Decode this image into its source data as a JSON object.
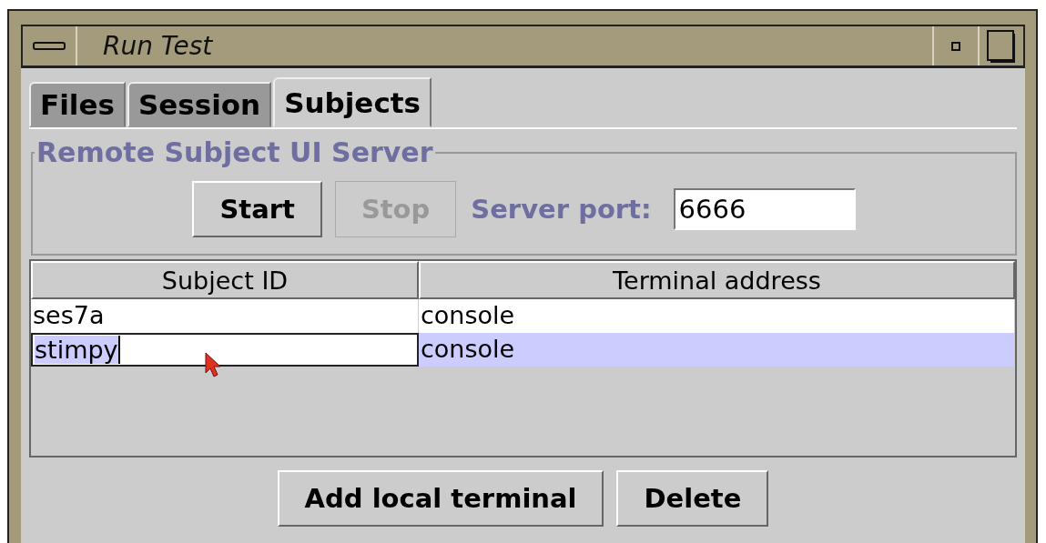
{
  "window": {
    "title": "Run Test"
  },
  "tabs": [
    {
      "label": "Files",
      "selected": false
    },
    {
      "label": "Session",
      "selected": false
    },
    {
      "label": "Subjects",
      "selected": true
    }
  ],
  "group": {
    "title": "Remote Subject UI Server",
    "buttons": [
      {
        "label": "Start",
        "disabled": false
      },
      {
        "label": "Stop",
        "disabled": true
      }
    ],
    "port_label": "Server port:",
    "port_value": "6666"
  },
  "table": {
    "columns": [
      "Subject ID",
      "Terminal address"
    ],
    "rows": [
      {
        "cells": [
          "ses7a",
          "console"
        ],
        "selected": false,
        "editing": false
      },
      {
        "cells": [
          "stimpy",
          "console"
        ],
        "selected": true,
        "editing": true
      }
    ]
  },
  "buttons": [
    "Add local terminal",
    "Delete"
  ]
}
